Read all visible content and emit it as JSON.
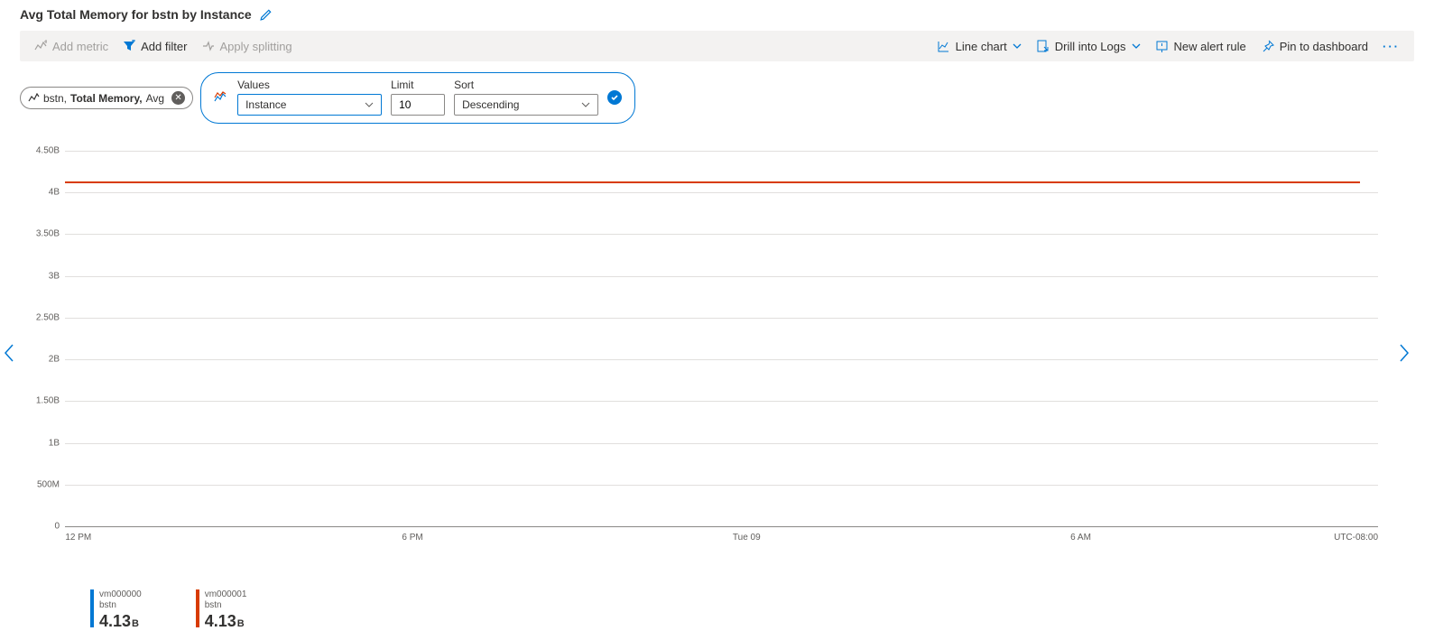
{
  "title": "Avg Total Memory for bstn by Instance",
  "toolbar": {
    "add_metric": "Add metric",
    "add_filter": "Add filter",
    "apply_splitting": "Apply splitting",
    "line_chart": "Line chart",
    "drill_logs": "Drill into Logs",
    "new_alert": "New alert rule",
    "pin": "Pin to dashboard"
  },
  "metric_pill": {
    "resource": "bstn,",
    "metric": "Total Memory,",
    "agg": "Avg"
  },
  "split": {
    "values_label": "Values",
    "values_selected": "Instance",
    "limit_label": "Limit",
    "limit_value": "10",
    "sort_label": "Sort",
    "sort_selected": "Descending"
  },
  "axes": {
    "y_ticks": [
      "4.50B",
      "4B",
      "3.50B",
      "3B",
      "2.50B",
      "2B",
      "1.50B",
      "1B",
      "500M",
      "0"
    ],
    "x_ticks": [
      "12 PM",
      "6 PM",
      "Tue 09",
      "6 AM"
    ],
    "tz": "UTC-08:00"
  },
  "legend": [
    {
      "name": "vm000000",
      "resource": "bstn",
      "value": "4.13",
      "unit": "B",
      "color": "#0078d4"
    },
    {
      "name": "vm000001",
      "resource": "bstn",
      "value": "4.13",
      "unit": "B",
      "color": "#d83b01"
    }
  ],
  "chart_data": {
    "type": "line",
    "title": "Avg Total Memory for bstn by Instance",
    "xlabel": "",
    "ylabel": "",
    "ylim": [
      0,
      4500000000
    ],
    "x": [
      "12 PM",
      "6 PM",
      "Tue 09",
      "6 AM"
    ],
    "series": [
      {
        "name": "vm000000",
        "color": "#0078d4",
        "values": [
          4130000000,
          4130000000,
          4130000000,
          4130000000
        ]
      },
      {
        "name": "vm000001",
        "color": "#d83b01",
        "values": [
          4130000000,
          4130000000,
          4130000000,
          4130000000
        ]
      }
    ]
  }
}
